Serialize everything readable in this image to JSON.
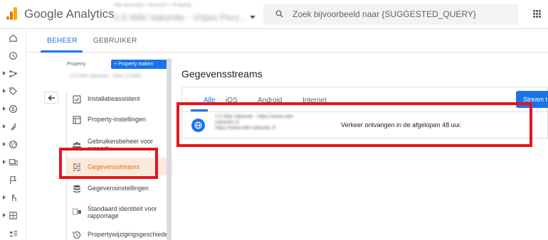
{
  "app": {
    "brand": "Google Analytics",
    "account_crumbs": "Alle accounts > Account > Property",
    "account_name": "2.0 Wiki Vakantie - Vrijwo Pers...",
    "search_placeholder": "Zoek bijvoorbeeld naar {SUGGESTED_QUERY}"
  },
  "tabs": [
    {
      "label": "BEHEER"
    },
    {
      "label": "GEBRUIKER"
    }
  ],
  "nav": {
    "property_label": "Property",
    "create_button": "Property maken",
    "property_sub": "2.0 Wiki Vakantie - GA4 (12345)",
    "items": [
      {
        "label": "Installatieassistent",
        "icon": "checklist-icon"
      },
      {
        "label": "Property-instellingen",
        "icon": "settings-window-icon"
      },
      {
        "label": "Gebruikersbeheer voor property",
        "icon": "users-icon"
      },
      {
        "label": "Gegevensstreams",
        "icon": "data-streams-icon"
      },
      {
        "label": "Gegevensinstellingen",
        "icon": "database-icon"
      },
      {
        "label": "Standaard identiteit voor rapportage",
        "icon": "identity-icon"
      },
      {
        "label": "Propertywijzigingsgeschieden",
        "icon": "history-icon"
      }
    ]
  },
  "main": {
    "title": "Gegevensstreams",
    "stream_tabs": [
      {
        "label": "Alle"
      },
      {
        "label": "iOS"
      },
      {
        "label": "Android"
      },
      {
        "label": "Internet"
      }
    ],
    "add_stream_button": "Stream t",
    "stream": {
      "name_line1": "2.0 Wiki Vakantie - https://www.wiki-",
      "name_line2": "vakantie.nl",
      "name_line3": "https://www.wiki-vakantie.nl",
      "status": "Verkeer ontvangen in de afgelopen 48 uur."
    }
  },
  "colors": {
    "accent": "#1a73e8",
    "selected_text": "#e8710a",
    "selected_bg": "#fde8dc",
    "annotation_red": "#e5141d"
  }
}
